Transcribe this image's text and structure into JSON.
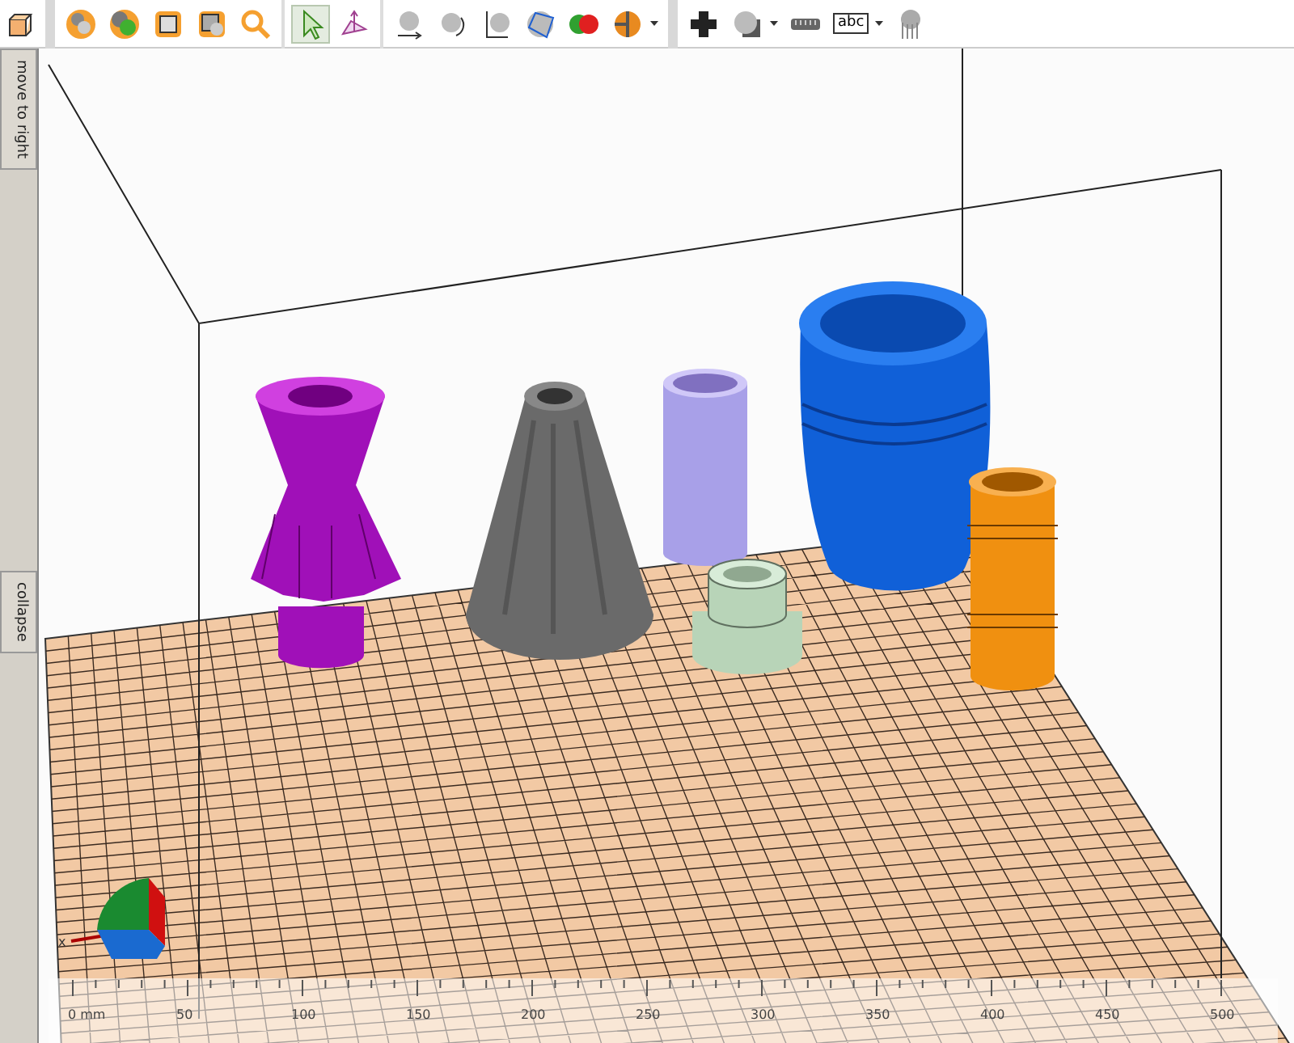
{
  "toolbar": {
    "groups": [
      [
        {
          "kind": "cube",
          "selected": false,
          "has_menu": false
        }
      ],
      [
        {
          "kind": "spheres",
          "selected": false,
          "has_menu": false
        },
        {
          "kind": "sphere-green",
          "selected": false,
          "has_menu": false
        },
        {
          "kind": "frame-box",
          "selected": false,
          "has_menu": false
        },
        {
          "kind": "frame-spheres",
          "selected": false,
          "has_menu": false
        },
        {
          "kind": "magnifier",
          "selected": false,
          "has_menu": false
        }
      ],
      [
        {
          "kind": "pointer",
          "selected": true,
          "has_menu": false
        },
        {
          "kind": "axes",
          "selected": false,
          "has_menu": false
        }
      ],
      [
        {
          "kind": "sphere-move",
          "selected": false,
          "has_menu": false
        },
        {
          "kind": "sphere-rotate",
          "selected": false,
          "has_menu": false
        },
        {
          "kind": "sphere-axes",
          "selected": false,
          "has_menu": false
        },
        {
          "kind": "sphere-wire",
          "selected": false,
          "has_menu": false
        },
        {
          "kind": "two-spheres",
          "selected": false,
          "has_menu": false
        },
        {
          "kind": "sphere-pie",
          "selected": false,
          "has_menu": true
        }
      ],
      [
        {
          "kind": "plus",
          "selected": false,
          "has_menu": false
        },
        {
          "kind": "sphere-square",
          "selected": false,
          "has_menu": true
        },
        {
          "kind": "ruler",
          "selected": false,
          "has_menu": false
        },
        {
          "kind": "text",
          "label": "abc",
          "selected": false,
          "has_menu": true
        },
        {
          "kind": "support",
          "selected": false,
          "has_menu": false
        }
      ]
    ]
  },
  "side_tabs": [
    {
      "label": "move to right"
    },
    {
      "label": "collapse"
    }
  ],
  "viewport": {
    "objects": [
      {
        "kind": "flared-vase",
        "color": "#a010b8"
      },
      {
        "kind": "cone",
        "color": "#6a6a6a"
      },
      {
        "kind": "tube",
        "color": "#a8a0e8"
      },
      {
        "kind": "stepped",
        "color": "#b8d4b8"
      },
      {
        "kind": "pot",
        "color": "#1060d8"
      },
      {
        "kind": "bushing",
        "color": "#f09010"
      }
    ],
    "axis_label": "x",
    "ruler": {
      "labels": [
        "0 mm",
        "50",
        "100",
        "150",
        "200",
        "250",
        "300",
        "350",
        "400",
        "450",
        "500"
      ]
    }
  }
}
